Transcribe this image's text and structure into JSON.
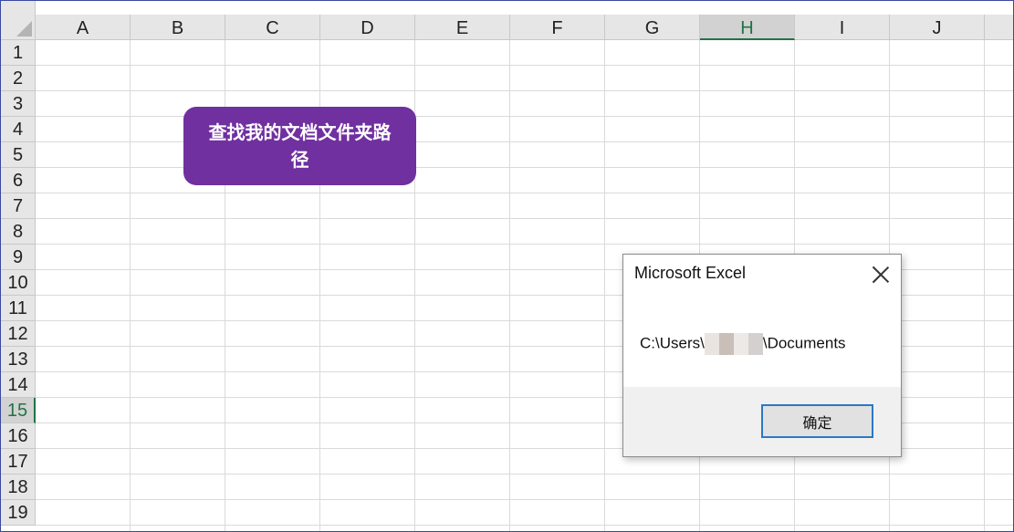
{
  "sheet": {
    "columns": [
      "A",
      "B",
      "C",
      "D",
      "E",
      "F",
      "G",
      "H",
      "I",
      "J"
    ],
    "selected_column": "H",
    "rows": [
      "1",
      "2",
      "3",
      "4",
      "5",
      "6",
      "7",
      "8",
      "9",
      "10",
      "11",
      "12",
      "13",
      "14",
      "15",
      "16",
      "17",
      "18",
      "19"
    ],
    "selected_row": "15"
  },
  "macro_button": {
    "label": "查找我的文档文件夹路径",
    "fill_color": "#7030a0",
    "text_color": "#ffffff"
  },
  "dialog": {
    "title": "Microsoft Excel",
    "message_prefix": "C:\\Users\\",
    "message_suffix": "\\Documents",
    "ok_label": "确定",
    "close_icon": "close-icon"
  }
}
